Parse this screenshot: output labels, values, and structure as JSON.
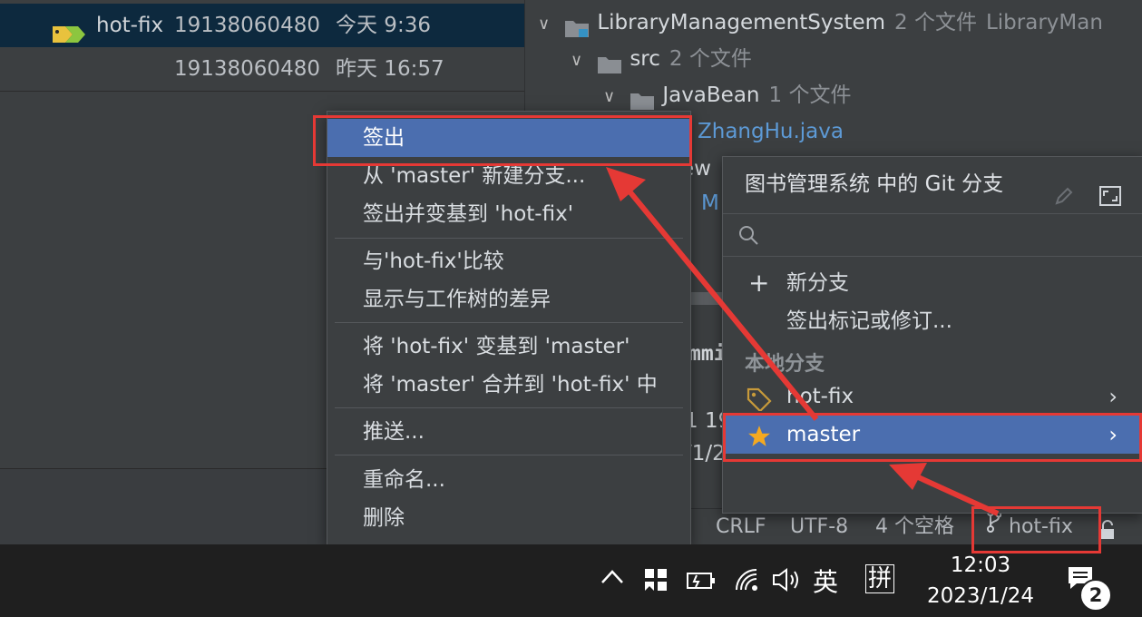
{
  "log": {
    "rows": [
      {
        "branch": "hot-fix",
        "author": "19138060480",
        "date": "今天 9:36",
        "selected": true
      },
      {
        "branch": "",
        "author": "19138060480",
        "date": "昨天 16:57",
        "selected": false
      }
    ]
  },
  "tree": {
    "project": {
      "name": "LibraryManagementSystem",
      "meta": "2 个文件",
      "path": "LibraryMan"
    },
    "src": {
      "name": "src",
      "meta": "2 个文件"
    },
    "javabean": {
      "name": "JavaBean",
      "meta": "1 个文件"
    },
    "file": {
      "name": "ZhangHu.java"
    },
    "partial_view": "ew",
    "partial_m": "M",
    "partial_commit": "mmi",
    "partial_info1": "1 19",
    "partial_info2": "/1/2"
  },
  "context_menu": {
    "items": [
      {
        "label": "签出",
        "active": true
      },
      {
        "label": "从 'master' 新建分支..."
      },
      {
        "label": "签出并变基到 'hot-fix'"
      },
      {
        "label": "与'hot-fix'比较"
      },
      {
        "label": "显示与工作树的差异"
      },
      {
        "label": "将 'hot-fix' 变基到 'master'"
      },
      {
        "label": "将 'master' 合并到 'hot-fix' 中"
      },
      {
        "label": "推送..."
      },
      {
        "label": "重命名..."
      },
      {
        "label": "删除"
      }
    ]
  },
  "git_popup": {
    "title": "图书管理系统 中的 Git 分支",
    "search_placeholder": "",
    "new_branch": "新分支",
    "checkout_tag": "签出标记或修订...",
    "local_section": "本地分支",
    "branches": [
      {
        "name": "hot-fix",
        "icon": "tag-icon",
        "active": false
      },
      {
        "name": "master",
        "icon": "star-icon",
        "active": true
      }
    ]
  },
  "status_bar": {
    "line_sep": "CRLF",
    "encoding": "UTF-8",
    "indent": "4 个空格",
    "branch": "hot-fix"
  },
  "taskbar": {
    "ime_lang": "英",
    "ime_mode": "拼",
    "time": "12:03",
    "date": "2023/1/24",
    "notif_count": "2"
  },
  "colors": {
    "accent": "#4b6eaf",
    "annotation": "#e53935",
    "tag_green": "#8cc63f",
    "tag_yellow": "#e8c23d",
    "star": "#f4a921"
  }
}
